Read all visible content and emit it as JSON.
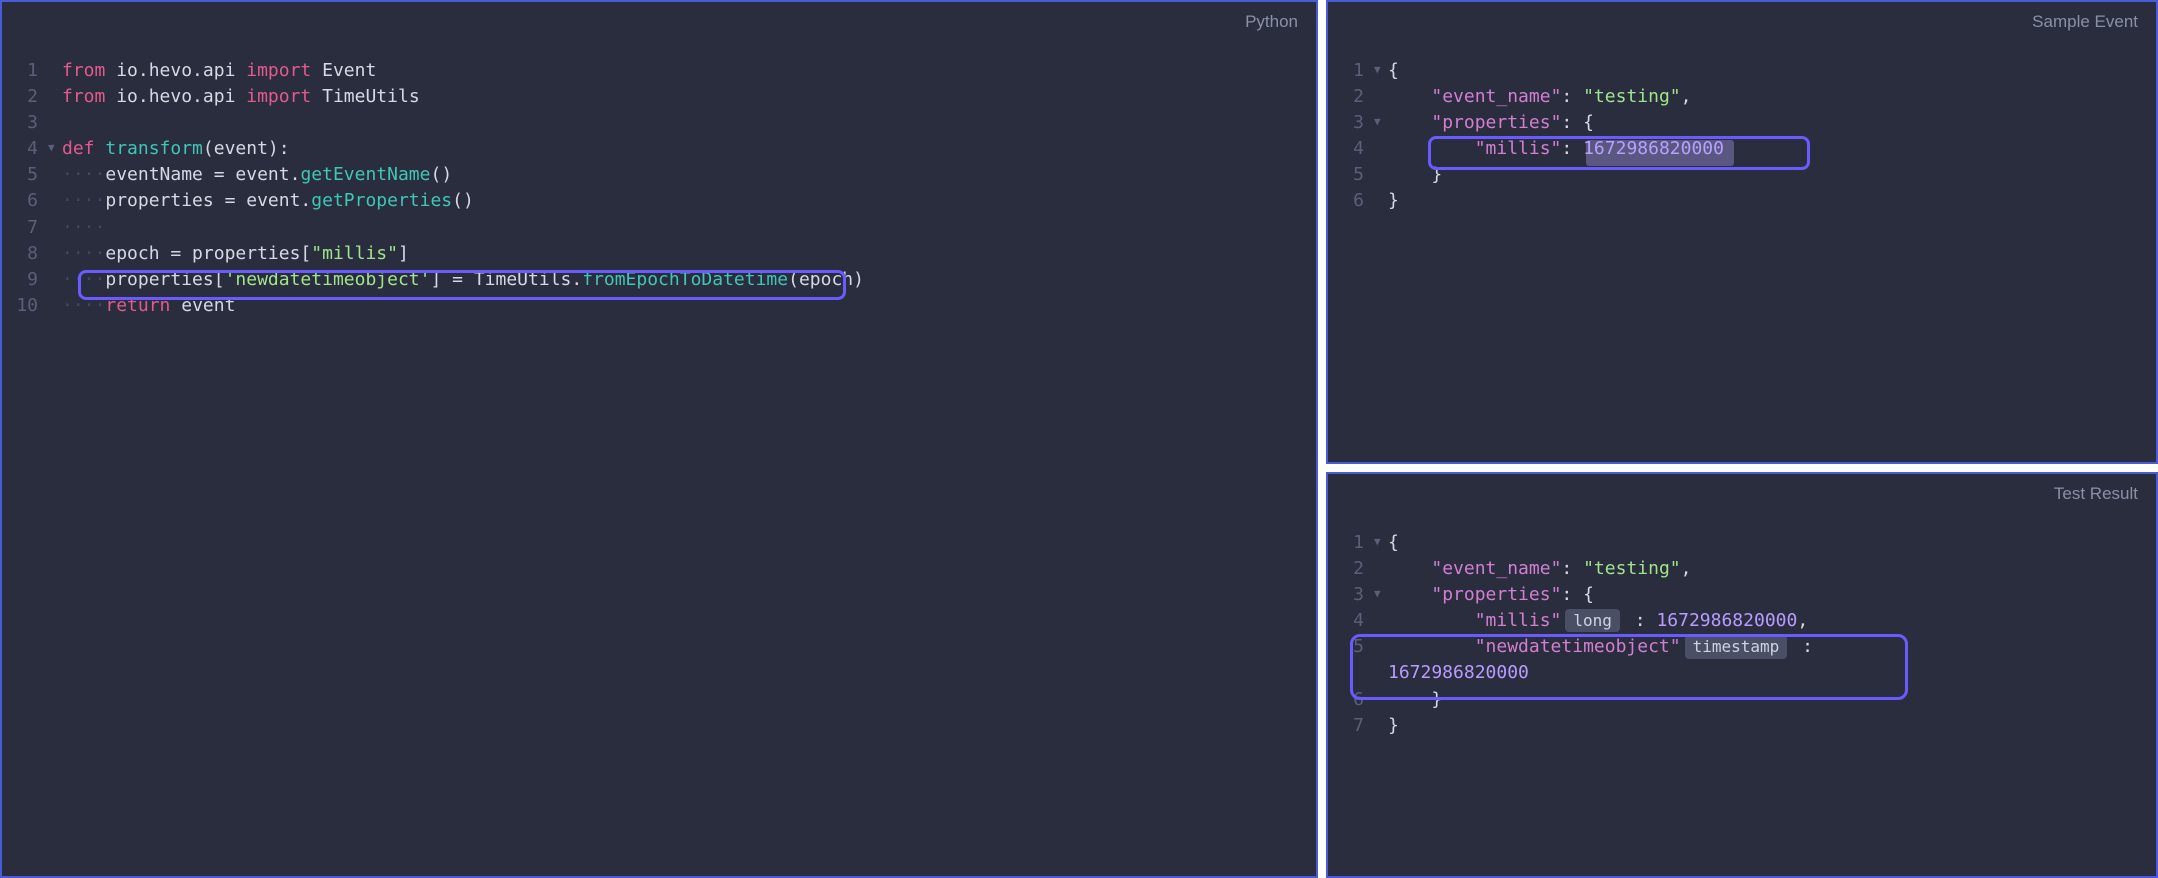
{
  "panes": {
    "left": {
      "title": "Python"
    },
    "sample": {
      "title": "Sample Event"
    },
    "result": {
      "title": "Test Result"
    }
  },
  "left_code": {
    "l1": {
      "n": "1",
      "from": "from",
      "white": " io.hevo.api ",
      "import": "import",
      "white2": " Event"
    },
    "l2": {
      "n": "2",
      "from": "from",
      "white": " io.hevo.api ",
      "import": "import",
      "white2": " TimeUtils"
    },
    "l3": {
      "n": "3",
      "body": ""
    },
    "l4": {
      "n": "4",
      "def": "def",
      "name": " transform",
      "rest": "(event):"
    },
    "l5": {
      "n": "5",
      "dots": "····",
      "body_a": "eventName = event.",
      "call": "getEventName",
      "body_b": "()"
    },
    "l6": {
      "n": "6",
      "dots": "····",
      "body_a": "properties = event.",
      "call": "getProperties",
      "body_b": "()"
    },
    "l7": {
      "n": "7",
      "dots": "····",
      "body": ""
    },
    "l8": {
      "n": "8",
      "dots": "····",
      "body_a": "epoch = properties[",
      "s": "\"millis\"",
      "body_b": "]"
    },
    "l9": {
      "n": "9",
      "dots": "····",
      "body_a": "properties[",
      "s": "'newdatetimeobject'",
      "body_b": "] = TimeUtils.",
      "call": "fromEpochToDatetime",
      "body_c": "(epoch)"
    },
    "l10": {
      "n": "10",
      "dots": "····",
      "ret": "return",
      "body": " event"
    }
  },
  "sample": {
    "l1": {
      "n": "1",
      "body": "{"
    },
    "l2": {
      "n": "2",
      "ind": "    ",
      "k": "\"event_name\"",
      "sep": ": ",
      "v": "\"testing\"",
      "tail": ","
    },
    "l3": {
      "n": "3",
      "ind": "    ",
      "k": "\"properties\"",
      "sep": ": {",
      "tail": ""
    },
    "l4": {
      "n": "4",
      "ind": "        ",
      "k": "\"millis\"",
      "sep": ": ",
      "num": "1672986820000"
    },
    "l5": {
      "n": "5",
      "ind": "    ",
      "body": "}"
    },
    "l6": {
      "n": "6",
      "body": "}"
    }
  },
  "result": {
    "l1": {
      "n": "1",
      "body": "{"
    },
    "l2": {
      "n": "2",
      "ind": "    ",
      "k": "\"event_name\"",
      "sep": ": ",
      "v": "\"testing\"",
      "tail": ","
    },
    "l3": {
      "n": "3",
      "ind": "    ",
      "k": "\"properties\"",
      "sep": ": {"
    },
    "l4": {
      "n": "4",
      "ind": "        ",
      "k": "\"millis\"",
      "badge": "long",
      "sep": " : ",
      "num": "1672986820000",
      "tail": ","
    },
    "l5a": {
      "n": "5",
      "ind": "        ",
      "k": "\"newdatetimeobject\"",
      "badge": "timestamp",
      "sep": " : "
    },
    "l5b": {
      "num": "1672986820000"
    },
    "l6": {
      "n": "6",
      "ind": "    ",
      "body": "}"
    },
    "l7": {
      "n": "7",
      "body": "}"
    }
  }
}
